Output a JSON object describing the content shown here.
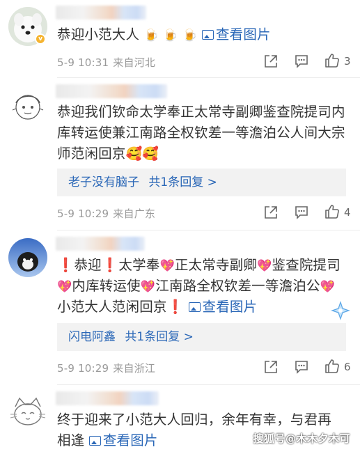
{
  "comments": [
    {
      "text": "恭迎小范大人",
      "emojis": [
        "🍺",
        "🍺",
        "🍺"
      ],
      "view_pic": "查看图片",
      "date": "5-9 10:31",
      "source": "来自河北",
      "likes": "3"
    },
    {
      "text": "恭迎我们钦命太学奉正太常寺副卿鉴查院提司内库转运使兼江南路全权钦差一等澹泊公人间大宗师范闲回京",
      "emojis": [
        "🥰",
        "🥰"
      ],
      "reply_user": "老子没有脑子",
      "reply_count": "共1条回复 >",
      "date": "5-9 10:29",
      "source": "来自广东",
      "likes": "4"
    },
    {
      "segments": [
        "❗",
        "恭迎",
        "❗",
        "太学奉",
        "💖",
        "正太常寺副卿",
        "💖",
        "鉴查院提司",
        "💖",
        "内库转运使",
        "💖",
        "江南路全权钦差一等澹泊公",
        "💖",
        "小范大人范闲回京",
        "❗"
      ],
      "view_pic": "查看图片",
      "reply_user": "闪电阿鑫",
      "reply_count": "共1条回复 >",
      "date": "5-9 10:29",
      "source": "来自浙江",
      "likes": "6"
    },
    {
      "text": "终于迎来了小范大人回归，余年有幸，与君再相逢",
      "view_pic": "查看图片"
    }
  ],
  "watermark": "搜狐号@木木夕木可",
  "colors": {
    "link": "#2a67b7",
    "meta": "#999999",
    "reply_bg": "#f2f2f2",
    "exclaim": "#e0312d"
  }
}
